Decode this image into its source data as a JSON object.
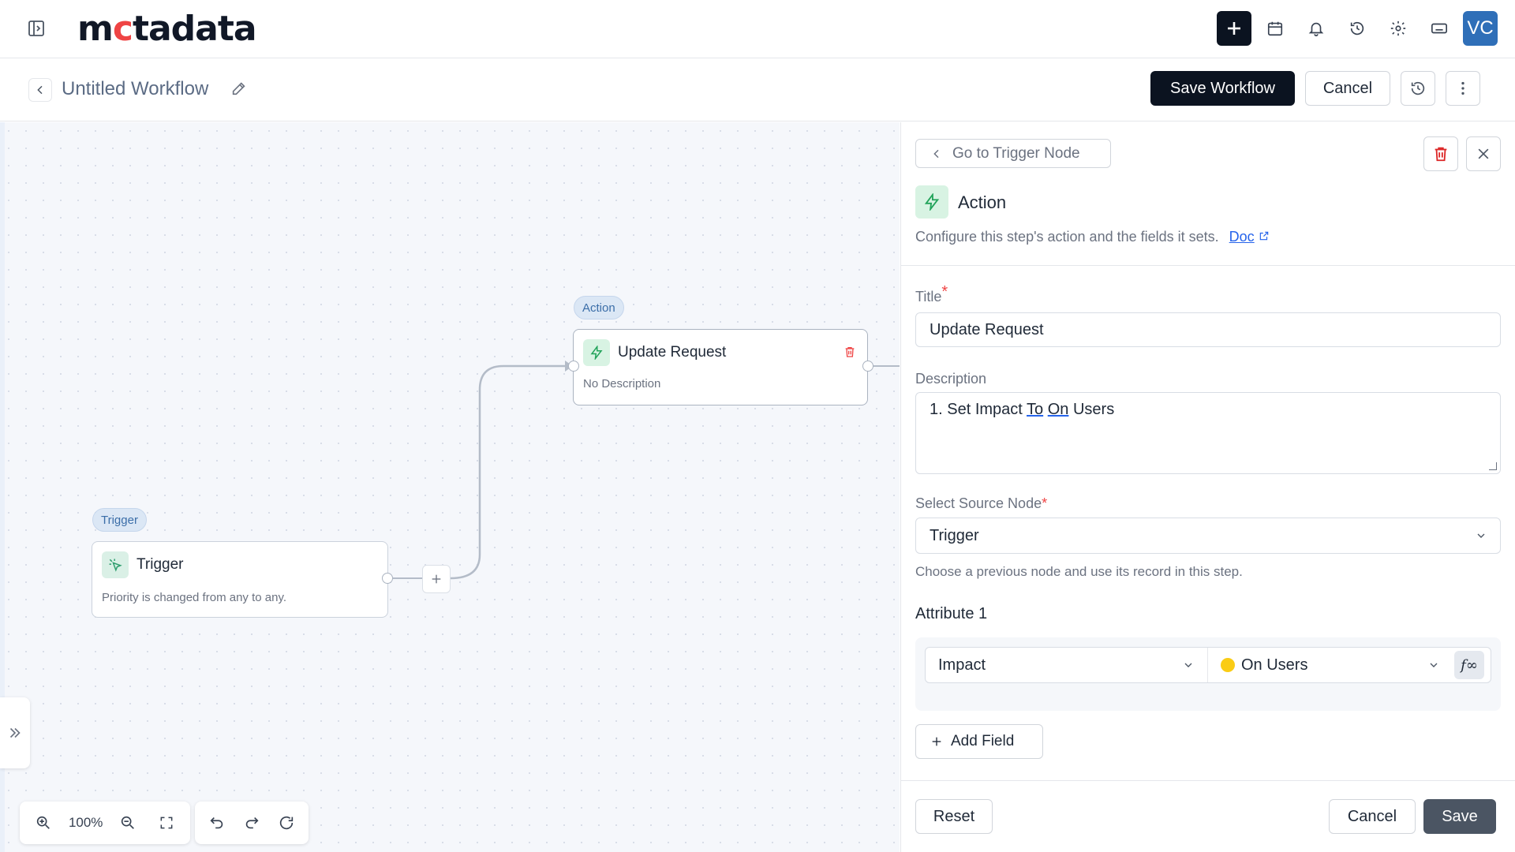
{
  "app": {
    "logo_pre": "m",
    "logo_dot": "c",
    "logo_post": "tadata",
    "avatar_initials": "VC",
    "accent": "#0b1320",
    "avatar_color": "#2f6fb8"
  },
  "topbar": {
    "icons": [
      "sidebar-toggle-icon",
      "plus-icon",
      "calendar-icon",
      "bell-icon",
      "history-icon",
      "gear-icon",
      "keyboard-icon"
    ]
  },
  "workflow": {
    "title": "Untitled Workflow",
    "save_label": "Save Workflow",
    "cancel_label": "Cancel"
  },
  "canvas": {
    "zoom": "100%",
    "trigger_node": {
      "badge": "Trigger",
      "title": "Trigger",
      "description": "Priority is changed from any to any."
    },
    "action_node": {
      "badge": "Action",
      "title": "Update Request",
      "description": "No Description"
    }
  },
  "panel": {
    "goto_label": "Go to Trigger Node",
    "heading": "Action",
    "subtitle": "Configure this step's action and the fields it sets.",
    "doc_label": "Doc",
    "title_label": "Title",
    "title_value": "Update Request",
    "description_label": "Description",
    "description_parts": [
      "1. Set Impact ",
      "To",
      " ",
      "On",
      " Users"
    ],
    "source_label": "Select Source Node",
    "source_value": "Trigger",
    "source_hint": "Choose a previous node and use its record in this step.",
    "attribute_label": "Attribute 1",
    "attribute_field": "Impact",
    "attribute_value": "On Users",
    "attribute_value_color": "#facc15",
    "fx_label": "f∞",
    "add_field_label": "Add Field",
    "reset_label": "Reset",
    "cancel_label": "Cancel",
    "save_label": "Save"
  }
}
